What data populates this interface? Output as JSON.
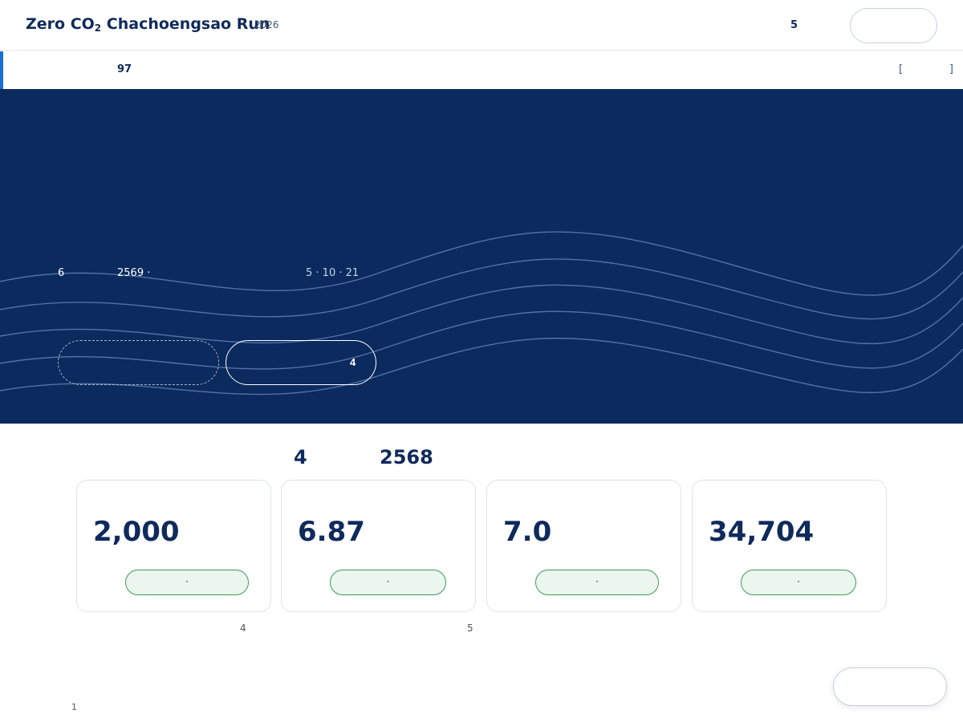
{
  "header": {
    "brand_pre": "Zero CO",
    "brand_sub": "2",
    "brand_post": " Chachoengsao Run",
    "year": "2026",
    "count": "5",
    "pill_label": ""
  },
  "notice": {
    "number": "97",
    "link_open": "[",
    "link_close": "]"
  },
  "hero": {
    "line_a": "6",
    "line_b": "2569 ·",
    "line_c": "5 · 10 · 21",
    "primary_button_label": "",
    "secondary_button_label": "4",
    "colors": {
      "background": "#0b2a5e",
      "wave": "#5f80b5"
    }
  },
  "stats": {
    "heading_a": "4",
    "heading_b": "2568",
    "cards": [
      {
        "value": "2,000",
        "chip": "·"
      },
      {
        "value": "6.87",
        "chip": "·"
      },
      {
        "value": "7.0",
        "chip": "·"
      },
      {
        "value": "34,704",
        "chip": "·"
      }
    ],
    "note_a": "4",
    "note_b": "5"
  },
  "footer": {
    "page": "1",
    "floating_pill_label": ""
  }
}
